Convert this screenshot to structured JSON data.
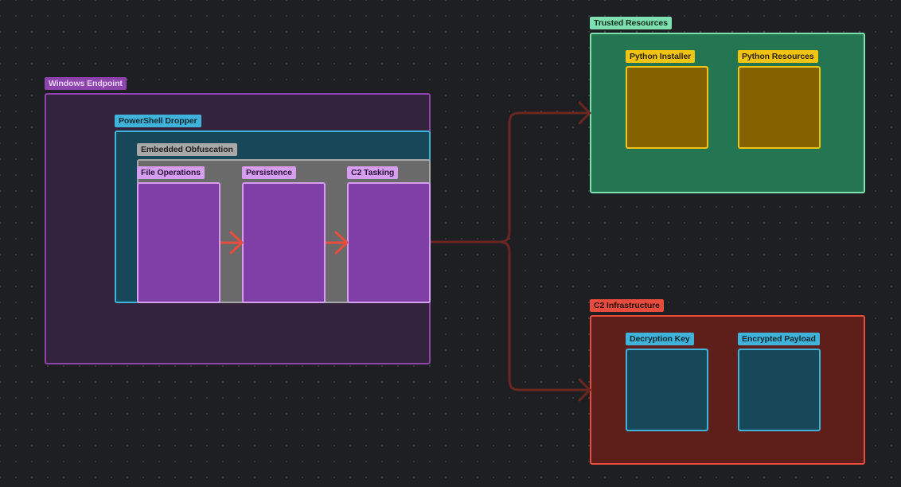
{
  "groups": {
    "windows_endpoint": {
      "label": "Windows Endpoint"
    },
    "powershell_dropper": {
      "label": "PowerShell Dropper"
    },
    "embedded_obfuscation": {
      "label": "Embedded Obfuscation"
    },
    "trusted_resources": {
      "label": "Trusted Resources"
    },
    "c2_infrastructure": {
      "label": "C2 Infrastructure"
    }
  },
  "nodes": {
    "file_operations": {
      "label": "File Operations"
    },
    "persistence": {
      "label": "Persistence"
    },
    "c2_tasking": {
      "label": "C2 Tasking"
    },
    "python_installer": {
      "label": "Python Installer"
    },
    "python_resources": {
      "label": "Python Resources"
    },
    "decryption_key": {
      "label": "Decryption Key"
    },
    "encrypted_payload": {
      "label": "Encrypted Payload"
    }
  },
  "colors": {
    "background": "#1e1f22",
    "purple_border": "#8e44ad",
    "purple_fill": "#7b3fa0",
    "cyan_border": "#3fb3d9",
    "cyan_fill": "#16485a",
    "gray_fill": "#6a6a6b",
    "green_border": "#7ee0b0",
    "green_fill": "#247552",
    "yellow_border": "#f1c40f",
    "yellow_fill": "#846200",
    "red_border": "#e74c3c",
    "red_fill": "#5e1f1b",
    "arrow_red": "#e74c3c",
    "wire_dark_red": "#6b2620"
  }
}
